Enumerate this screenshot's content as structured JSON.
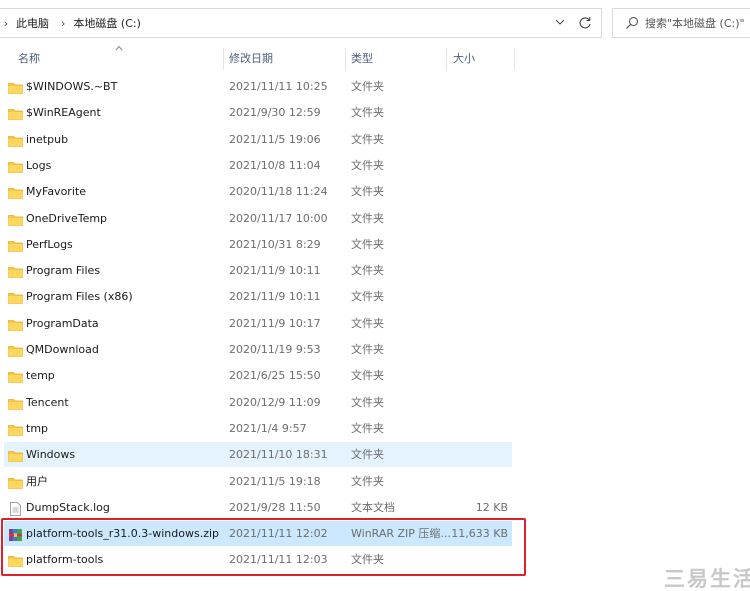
{
  "address": {
    "breadcrumb": [
      "此电脑",
      "本地磁盘 (C:)"
    ]
  },
  "search": {
    "placeholder": "搜索\"本地磁盘 (C:)\""
  },
  "columns": {
    "name": "名称",
    "date": "修改日期",
    "type": "类型",
    "size": "大小"
  },
  "files": [
    {
      "name": "$WINDOWS.~BT",
      "date": "2021/11/11 10:25",
      "type": "文件夹",
      "size": "",
      "icon": "folder-icon"
    },
    {
      "name": "$WinREAgent",
      "date": "2021/9/30 12:59",
      "type": "文件夹",
      "size": "",
      "icon": "folder-icon"
    },
    {
      "name": "inetpub",
      "date": "2021/11/5 19:06",
      "type": "文件夹",
      "size": "",
      "icon": "folder-icon"
    },
    {
      "name": "Logs",
      "date": "2021/10/8 11:04",
      "type": "文件夹",
      "size": "",
      "icon": "folder-icon"
    },
    {
      "name": "MyFavorite",
      "date": "2020/11/18 11:24",
      "type": "文件夹",
      "size": "",
      "icon": "folder-icon"
    },
    {
      "name": "OneDriveTemp",
      "date": "2020/11/17 10:00",
      "type": "文件夹",
      "size": "",
      "icon": "folder-icon"
    },
    {
      "name": "PerfLogs",
      "date": "2021/10/31 8:29",
      "type": "文件夹",
      "size": "",
      "icon": "folder-icon"
    },
    {
      "name": "Program Files",
      "date": "2021/11/9 10:11",
      "type": "文件夹",
      "size": "",
      "icon": "folder-icon"
    },
    {
      "name": "Program Files (x86)",
      "date": "2021/11/9 10:11",
      "type": "文件夹",
      "size": "",
      "icon": "folder-icon"
    },
    {
      "name": "ProgramData",
      "date": "2021/11/9 10:17",
      "type": "文件夹",
      "size": "",
      "icon": "folder-icon"
    },
    {
      "name": "QMDownload",
      "date": "2020/11/19 9:53",
      "type": "文件夹",
      "size": "",
      "icon": "folder-icon"
    },
    {
      "name": "temp",
      "date": "2021/6/25 15:50",
      "type": "文件夹",
      "size": "",
      "icon": "folder-icon"
    },
    {
      "name": "Tencent",
      "date": "2020/12/9 11:09",
      "type": "文件夹",
      "size": "",
      "icon": "folder-icon"
    },
    {
      "name": "tmp",
      "date": "2021/1/4 9:57",
      "type": "文件夹",
      "size": "",
      "icon": "folder-icon"
    },
    {
      "name": "Windows",
      "date": "2021/11/10 18:31",
      "type": "文件夹",
      "size": "",
      "icon": "folder-icon",
      "state": "hover"
    },
    {
      "name": "用户",
      "date": "2021/11/5 19:18",
      "type": "文件夹",
      "size": "",
      "icon": "folder-icon"
    },
    {
      "name": "DumpStack.log",
      "date": "2021/9/28 11:50",
      "type": "文本文档",
      "size": "12 KB",
      "icon": "text-file-icon"
    },
    {
      "name": "platform-tools_r31.0.3-windows.zip",
      "date": "2021/11/11 12:02",
      "type": "WinRAR ZIP 压缩...",
      "size": "11,633 KB",
      "icon": "winrar-zip-icon",
      "state": "selected"
    },
    {
      "name": "platform-tools",
      "date": "2021/11/11 12:03",
      "type": "文件夹",
      "size": "",
      "icon": "folder-icon"
    }
  ],
  "watermark": "三易生活",
  "colors": {
    "highlight": "#e0202a",
    "selected": "#cce8ff",
    "hover": "#e5f3ff",
    "folder": "#f8c93f"
  }
}
